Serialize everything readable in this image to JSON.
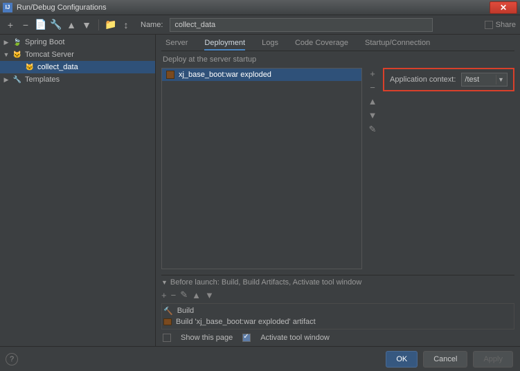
{
  "window": {
    "title": "Run/Debug Configurations"
  },
  "toolbar": {
    "share_label": "Share"
  },
  "name_field": {
    "label": "Name:",
    "value": "collect_data"
  },
  "tree": {
    "spring": "Spring Boot",
    "tomcat": "Tomcat Server",
    "collect": "collect_data",
    "templates": "Templates"
  },
  "tabs": {
    "server": "Server",
    "deployment": "Deployment",
    "logs": "Logs",
    "coverage": "Code Coverage",
    "startup": "Startup/Connection"
  },
  "deploy": {
    "section": "Deploy at the server startup",
    "item": "xj_base_boot:war exploded",
    "appctx_label": "Application context:",
    "appctx_value": "/test"
  },
  "before": {
    "header": "Before launch: Build, Build Artifacts, Activate tool window",
    "build": "Build",
    "artifact": "Build 'xj_base_boot:war exploded' artifact",
    "show_page": "Show this page",
    "activate": "Activate tool window"
  },
  "footer": {
    "ok": "OK",
    "cancel": "Cancel",
    "apply": "Apply"
  }
}
